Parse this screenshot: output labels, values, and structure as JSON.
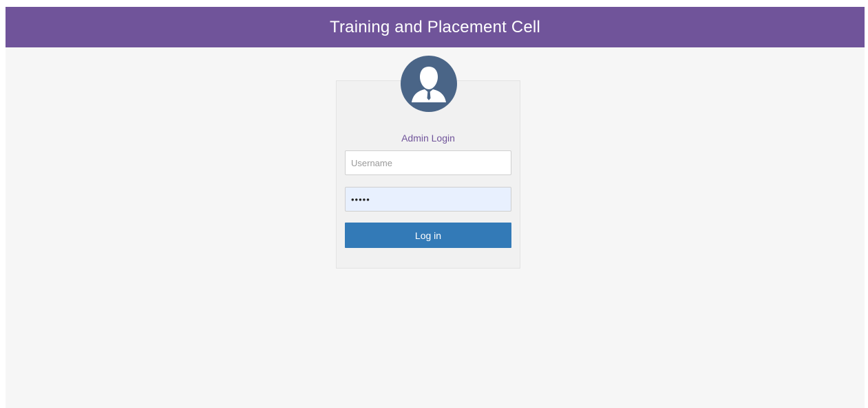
{
  "header": {
    "title": "Training and Placement Cell"
  },
  "login": {
    "avatar_icon": "user-avatar-icon",
    "title": "Admin Login",
    "username_placeholder": "Username",
    "password_value": "admin",
    "submit_label": "Log in"
  },
  "colors": {
    "header_bg": "#70549a",
    "avatar_bg": "#4a6587",
    "title_text": "#70549a",
    "button_bg": "#337ab7",
    "page_bg": "#f6f6f6"
  }
}
